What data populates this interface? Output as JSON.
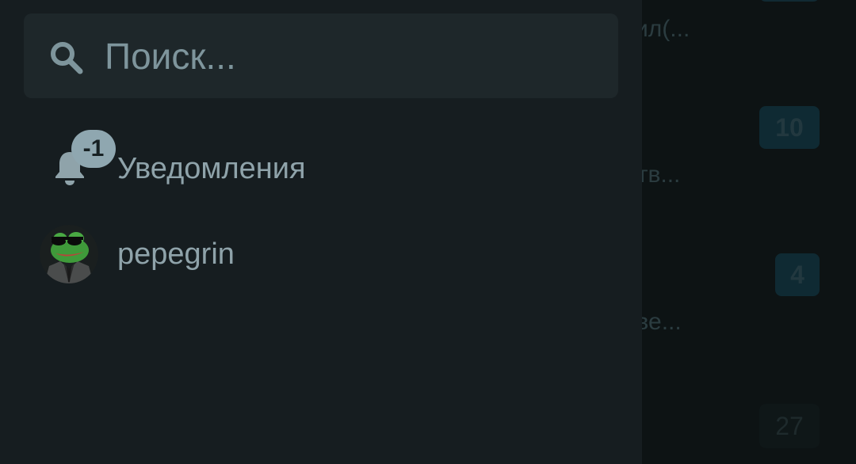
{
  "background_list": {
    "snippets": [
      "ветил(...",
      "in отв...",
      ", отве..."
    ],
    "badges": [
      "10",
      "4",
      "27"
    ]
  },
  "drawer": {
    "search": {
      "placeholder": "Поиск...",
      "value": ""
    },
    "notifications": {
      "label": "Уведомления",
      "badge": "-1"
    },
    "user": {
      "name": "pepegrin",
      "avatar": "avatar-pepe-frog-sunglasses"
    }
  },
  "colors": {
    "drawer_bg": "#161d20",
    "search_bg": "#1e272a",
    "text": "#8fa3aa",
    "badge_bg": "#8fa7b0"
  }
}
